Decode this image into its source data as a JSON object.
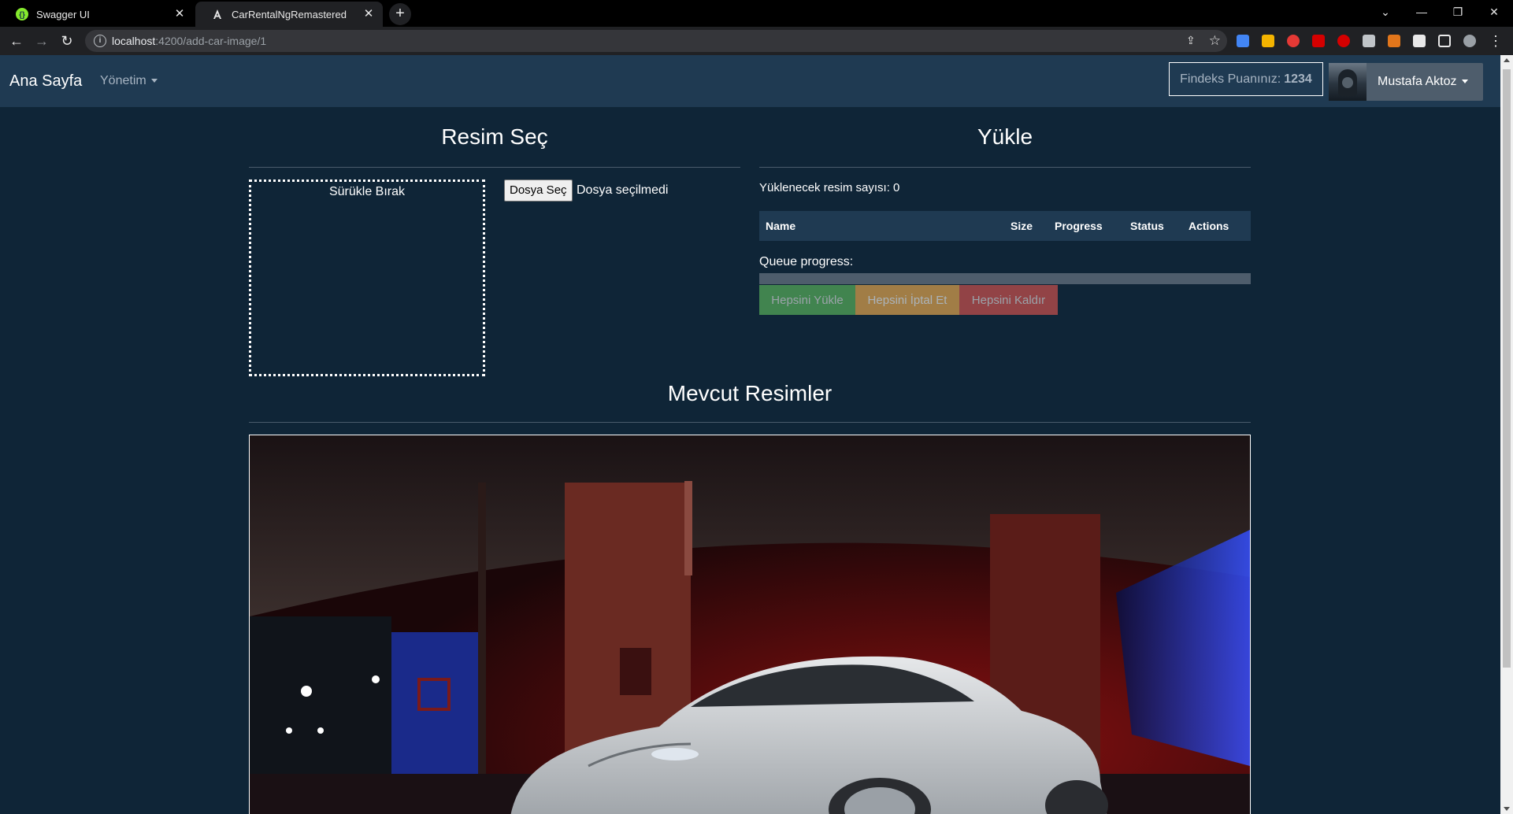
{
  "browser": {
    "tabs": [
      {
        "title": "Swagger UI",
        "active": false,
        "icon": "swagger-icon"
      },
      {
        "title": "CarRentalNgRemastered",
        "active": true,
        "icon": "angular-icon"
      }
    ],
    "url_host": "localhost",
    "url_path": ":4200/add-car-image/1"
  },
  "navbar": {
    "brand": "Ana Sayfa",
    "admin_menu": "Yönetim",
    "findeks_label": "Findeks Puanınız:",
    "findeks_value": "1234",
    "user_name": "Mustafa Aktoz"
  },
  "select_section": {
    "title": "Resim Seç",
    "dropzone_label": "Sürükle Bırak",
    "file_button": "Dosya Seç",
    "file_status": "Dosya seçilmedi"
  },
  "upload_section": {
    "title": "Yükle",
    "count_label": "Yüklenecek resim sayısı: 0",
    "columns": [
      "Name",
      "Size",
      "Progress",
      "Status",
      "Actions"
    ],
    "queue_label": "Queue progress:",
    "queue_progress": 0,
    "upload_all": "Hepsini Yükle",
    "cancel_all": "Hepsini İptal Et",
    "remove_all": "Hepsini Kaldır"
  },
  "existing_section": {
    "title": "Mevcut Resimler",
    "images": [
      "car-image-tesla-model-s"
    ]
  },
  "colors": {
    "page_bg": "#0f2537",
    "navbar_bg": "#1f3a52",
    "success": "#5cb85c",
    "warning": "#f0ad4e",
    "danger": "#d9534f"
  }
}
